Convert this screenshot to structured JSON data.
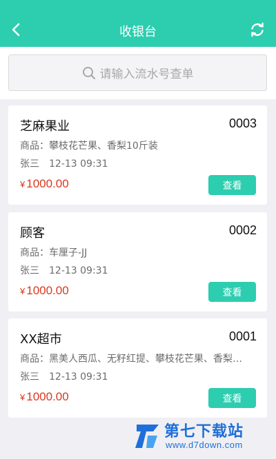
{
  "header": {
    "title": "收银台",
    "back_icon": "chevron-left-icon",
    "refresh_icon": "refresh-icon"
  },
  "search": {
    "placeholder": "请输入流水号查单"
  },
  "orders": [
    {
      "name": "芝麻果业",
      "number": "0003",
      "goods": "商品：攀枝花芒果、香梨10斤装",
      "cashier": "张三",
      "time": "12-13 09:31",
      "currency": "¥",
      "amount": "1000.00",
      "view_label": "查看"
    },
    {
      "name": "顾客",
      "number": "0002",
      "goods": "商品：车厘子-JJ",
      "cashier": "张三",
      "time": "12-13 09:31",
      "currency": "¥",
      "amount": "1000.00",
      "view_label": "查看"
    },
    {
      "name": "XX超市",
      "number": "0001",
      "goods": "商品：黑美人西瓜、无籽红提、攀枝花芒果、香梨…",
      "cashier": "张三",
      "time": "12-13 09:31",
      "currency": "¥",
      "amount": "1000.00",
      "view_label": "查看"
    }
  ],
  "watermark": {
    "title": "第七下载站",
    "url": "www.d7down.com"
  },
  "colors": {
    "accent": "#2dcdaf",
    "price": "#d9381e",
    "background": "#efeff4",
    "watermark": "#1e6fd9"
  }
}
